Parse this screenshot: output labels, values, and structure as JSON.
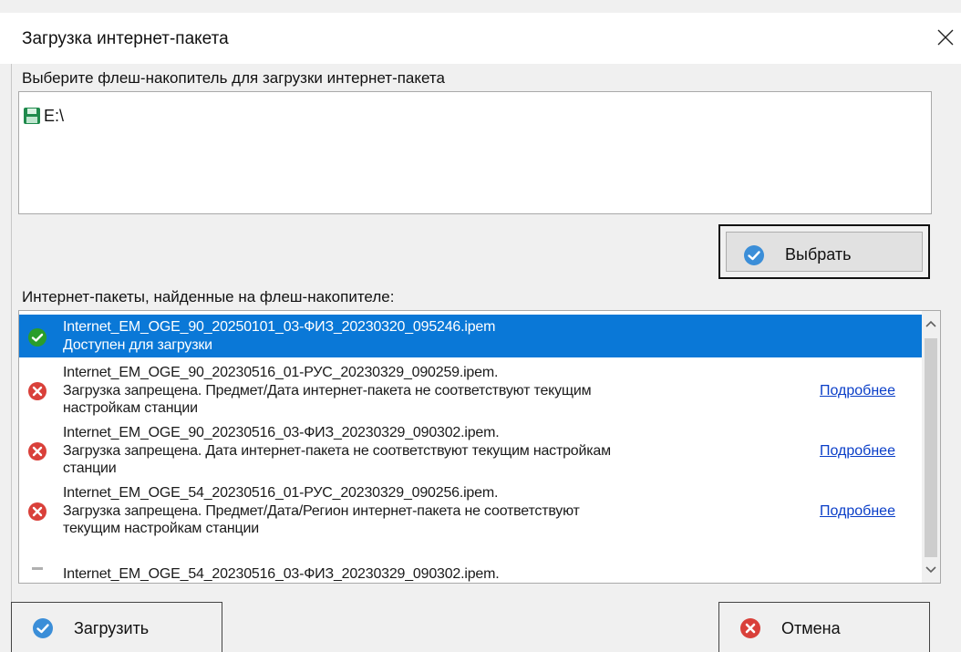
{
  "window": {
    "title": "Загрузка интернет-пакета"
  },
  "drives": {
    "label": "Выберите флеш-накопитель для загрузки интернет-пакета",
    "items": [
      {
        "name": "E:\\",
        "icon": "floppy-disk-icon"
      }
    ]
  },
  "select_button": {
    "label": "Выбрать",
    "icon": "check-circle-icon"
  },
  "packages": {
    "label": "Интернет-пакеты, найденные на флеш-накопителе:",
    "more_label": "Подробнее",
    "items": [
      {
        "selected": true,
        "status": "ok",
        "lines": [
          "Internet_EM_OGE_90_20250101_03-ФИЗ_20230320_095246.ipem",
          "Доступен для загрузки"
        ]
      },
      {
        "selected": false,
        "status": "error",
        "lines": [
          "Internet_EM_OGE_90_20230516_01-РУС_20230329_090259.ipem.",
          "Загрузка запрещена. Предмет/Дата интернет-пакета не соответствуют текущим",
          "настройкам станции"
        ]
      },
      {
        "selected": false,
        "status": "error",
        "lines": [
          "Internet_EM_OGE_90_20230516_03-ФИЗ_20230329_090302.ipem.",
          "Загрузка запрещена. Дата интернет-пакета не соответствуют текущим настройкам",
          "станции"
        ]
      },
      {
        "selected": false,
        "status": "error",
        "lines": [
          "Internet_EM_OGE_54_20230516_01-РУС_20230329_090256.ipem.",
          "Загрузка запрещена. Предмет/Дата/Регион интернет-пакета не соответствуют",
          "текущим настройкам станции"
        ]
      },
      {
        "selected": false,
        "status": "partial",
        "lines": [
          "Internet_EM_OGE_54_20230516_03-ФИЗ_20230329_090302.ipem."
        ]
      }
    ]
  },
  "load_button": {
    "label": "Загрузить",
    "icon": "check-circle-icon"
  },
  "cancel_button": {
    "label": "Отмена",
    "icon": "error-circle-icon"
  },
  "colors": {
    "selection": "#0a78d7",
    "ok": "#2a9d2a",
    "error": "#d9403a",
    "link": "#0a3ec8",
    "button_icon": "#3b8ed8"
  }
}
